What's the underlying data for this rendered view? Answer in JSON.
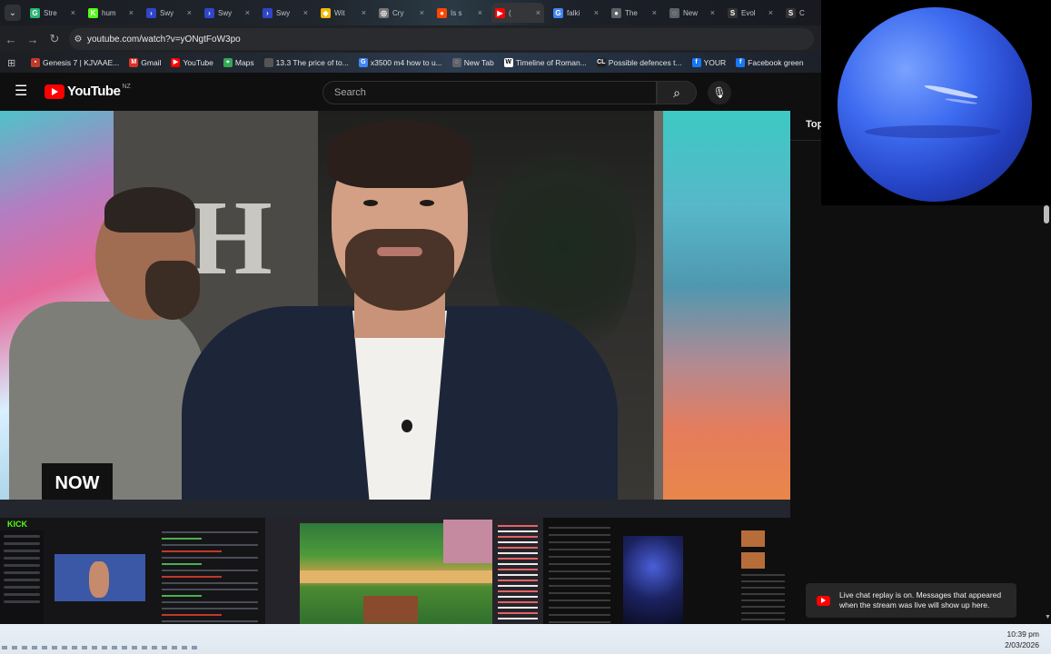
{
  "browser": {
    "tabs": [
      {
        "label": "Stre",
        "icon": "green-square-icon",
        "color": "#2bb673",
        "glyph": "G"
      },
      {
        "label": "hum",
        "icon": "kick-icon",
        "color": "#53fc18",
        "glyph": "K"
      },
      {
        "label": "Swy",
        "icon": "swyftx-icon",
        "color": "#2f46c9",
        "glyph": "›"
      },
      {
        "label": "Swy",
        "icon": "swyftx-icon",
        "color": "#2f46c9",
        "glyph": "›"
      },
      {
        "label": "Swy",
        "icon": "swyftx-icon",
        "color": "#2f46c9",
        "glyph": "›"
      },
      {
        "label": "Wit",
        "icon": "binance-icon",
        "color": "#f0b90b",
        "glyph": "◆"
      },
      {
        "label": "Cry",
        "icon": "coin-icon",
        "color": "#777777",
        "glyph": "◎"
      },
      {
        "label": "Is s",
        "icon": "reddit-icon",
        "color": "#ff4500",
        "glyph": "●"
      },
      {
        "label": "(",
        "icon": "youtube-icon",
        "color": "#ff0000",
        "glyph": "▶",
        "active": true
      },
      {
        "label": "falki",
        "icon": "google-icon",
        "color": "#4285f4",
        "glyph": "G"
      },
      {
        "label": "The",
        "icon": "globe-icon",
        "color": "#5f6368",
        "glyph": "●"
      },
      {
        "label": "New",
        "icon": "new-tab-icon",
        "color": "#5f6368",
        "glyph": "◌"
      },
      {
        "label": "Evol",
        "icon": "s-icon",
        "color": "#333333",
        "glyph": "S"
      },
      {
        "label": "C",
        "icon": "s-icon",
        "color": "#333333",
        "glyph": "S"
      }
    ],
    "close_glyph": "×",
    "menu_glyph": "⌄",
    "nav": {
      "back": "←",
      "forward": "→",
      "reload": "↻"
    },
    "url": "youtube.com/watch?v=yONgtFoW3po",
    "bookmarks": [
      {
        "label": "Genesis 7 | KJVAAE...",
        "icon": "bible-icon",
        "color": "#c0392b",
        "glyph": "▪"
      },
      {
        "label": "Gmail",
        "icon": "gmail-icon",
        "color": "#d93025",
        "glyph": "M"
      },
      {
        "label": "YouTube",
        "icon": "youtube-icon",
        "color": "#ff0000",
        "glyph": "▶"
      },
      {
        "label": "Maps",
        "icon": "maps-icon",
        "color": "#34a853",
        "glyph": "⌖"
      },
      {
        "label": "13.3 The price of to...",
        "icon": "doc-icon",
        "color": "#555555",
        "glyph": ""
      },
      {
        "label": "x3500 m4 how to u...",
        "icon": "google-icon",
        "color": "#4285f4",
        "glyph": "G"
      },
      {
        "label": "New Tab",
        "icon": "new-tab-icon",
        "color": "#5f6368",
        "glyph": "◌"
      },
      {
        "label": "Timeline of Roman...",
        "icon": "wikipedia-icon",
        "color": "#ffffff",
        "glyph": "W"
      },
      {
        "label": "Possible defences t...",
        "icon": "cl-icon",
        "color": "#222222",
        "glyph": "CL"
      },
      {
        "label": "YOUR",
        "icon": "facebook-icon",
        "color": "#1877f2",
        "glyph": "f"
      },
      {
        "label": "Facebook green",
        "icon": "facebook-icon",
        "color": "#1877f2",
        "glyph": "f"
      }
    ]
  },
  "youtube": {
    "logo_text": "YouTube",
    "region": "NZ",
    "search_placeholder": "Search",
    "search_glyph": "⌕",
    "mic_glyph": "🎙",
    "menu_glyph": "☰",
    "video": {
      "bg_logo": "H",
      "now_badge": "NOW"
    },
    "stream_strip": {
      "kick_logo": "KICK"
    },
    "chat": {
      "top_label": "Top",
      "notice": "Live chat replay is on. Messages that appeared when the stream was live will show up here."
    }
  },
  "taskbar": {
    "time": "10:39 pm",
    "date": "2/03/2026"
  },
  "colors": {
    "brand_red": "#ff0000",
    "kick_green": "#53fc18",
    "neptune_blue": "#3e6cf0"
  }
}
